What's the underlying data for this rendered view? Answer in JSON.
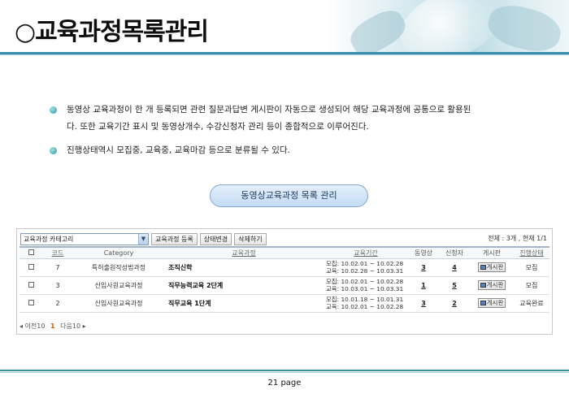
{
  "header": {
    "title": "○교육과정목록관리"
  },
  "bullets": [
    {
      "line1": "동영상 교육과정이 한 개 등록되면 관련 질문과답변 게시판이 자동으로 생성되어 해당 교육과정에 공통으로 활용된",
      "line2": "다. 또한 교육기간 표시 및 동영상개수, 수강신청자 관리 등이 종합적으로 이루어진다."
    },
    {
      "line1": "진행상태역시 모집중, 교육중, 교육마감 등으로 분류될 수 있다."
    }
  ],
  "pill": {
    "label": "동영상교육과정 목록 관리"
  },
  "toolbar": {
    "category_select": "교육과정 카테고리",
    "register_button": "교육과정 등록",
    "status_button": "상태변경",
    "delete_button": "삭제하기",
    "summary": "전체 : 3개 , 현재 1/1"
  },
  "table": {
    "headers": [
      "코드",
      "Category",
      "교육과정",
      "교육기간",
      "동영상",
      "신청자",
      "게시판",
      "진행상태"
    ],
    "rows": [
      {
        "code": "7",
        "category": "특허출원작성법과정",
        "course": "조직신학",
        "period1": "모집: 10.02.01 ~ 10.02.28",
        "period2": "교육: 10.02.28 ~ 10.03.31",
        "videos": "3",
        "applicants": "4",
        "board": "게시판",
        "status": "모집"
      },
      {
        "code": "3",
        "category": "신입사원교육과정",
        "course": "직무능력교육 2단계",
        "period1": "모집: 10.02.01 ~ 10.02.28",
        "period2": "교육: 10.03.01 ~ 10.03.31",
        "videos": "1",
        "applicants": "5",
        "board": "게시판",
        "status": "모집"
      },
      {
        "code": "2",
        "category": "신입사원교육과정",
        "course": "직무교육 1단계",
        "period1": "모집: 10.01.18 ~ 10.01.31",
        "period2": "교육: 10.02.01 ~ 10.02.28",
        "videos": "3",
        "applicants": "2",
        "board": "게시판",
        "status": "교육완료"
      }
    ]
  },
  "pager": {
    "prev": "◂ 이전10",
    "current": "1",
    "next": "다음10 ▸"
  },
  "footer": {
    "page": "21 page"
  },
  "colors": {
    "accent": "#3a8fb0",
    "pill_border": "#7ea7d0",
    "pager_current": "#d05a00"
  }
}
